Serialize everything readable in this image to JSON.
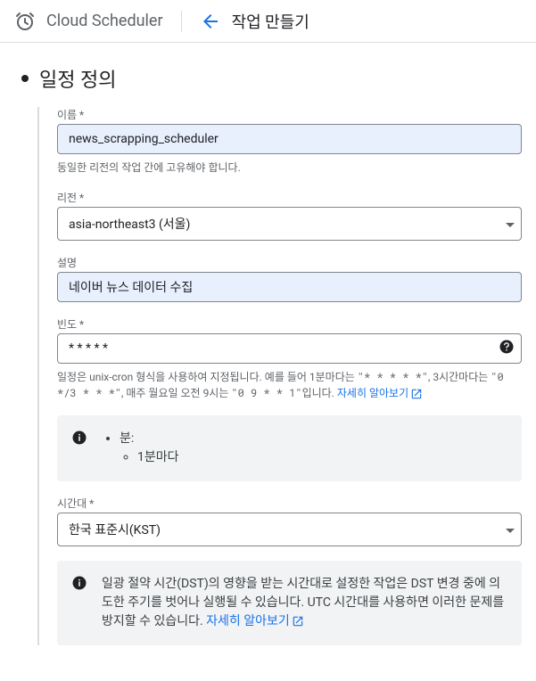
{
  "header": {
    "product": "Cloud Scheduler",
    "page_title": "작업 만들기"
  },
  "section": {
    "title": "일정 정의"
  },
  "fields": {
    "name": {
      "label": "이름 *",
      "value": "news_scrapping_scheduler",
      "helper": "동일한 리전의 작업 간에 고유해야 합니다."
    },
    "region": {
      "label": "리전 *",
      "value": "asia-northeast3 (서울)"
    },
    "description": {
      "label": "설명",
      "value": "네이버 뉴스 데이터 수집"
    },
    "frequency": {
      "label": "빈도 *",
      "value": "* * * * *",
      "helper_prefix": "일정은 unix-cron 형식을 사용하여 지정됩니다. 예를 들어 1분마다는 ",
      "helper_ex1": "\"*  *  *  *  *\"",
      "helper_mid1": ", 3시간마다는 ",
      "helper_ex2": "\"0  */3  *  *  *\"",
      "helper_mid2": ", 매주 월요일 오전 9시는 ",
      "helper_ex3": "\"0  9  *  *  1\"",
      "helper_suffix": "입니다. ",
      "learn_more": "자세히 알아보기"
    },
    "cron_preview": {
      "unit": "분:",
      "value": "1분마다"
    },
    "timezone": {
      "label": "시간대 *",
      "value": "한국 표준시(KST)"
    },
    "dst_warning": {
      "text": "일광 절약 시간(DST)의 영향을 받는 시간대로 설정한 작업은 DST 변경 중에 의도한 주기를 벗어나 실행될 수 있습니다. UTC 시간대를 사용하면 이러한 문제를 방지할 수 있습니다. ",
      "learn_more": "자세히 알아보기"
    }
  }
}
